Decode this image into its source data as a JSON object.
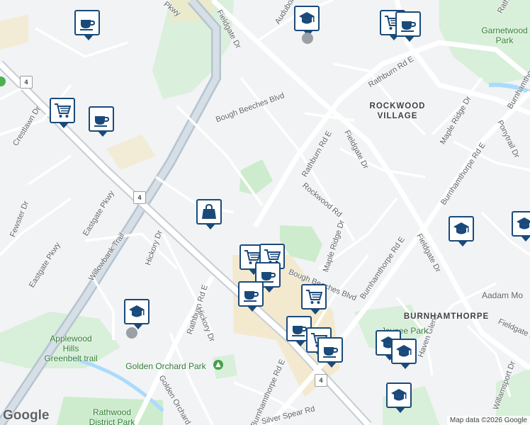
{
  "map": {
    "colors": {
      "land": "#f1f3f4",
      "road": "#ffffff",
      "highway": "#b6c4d1",
      "park": "#cdeccd",
      "water": "#aadaff",
      "commercial": "#f3e6c2",
      "marker_border": "#1a4a7a"
    },
    "streets": [
      {
        "name": "Eastgate Pkwy"
      },
      {
        "name": "Eastgate Pkwy"
      },
      {
        "name": "Pkwy"
      },
      {
        "name": "Fieldgate Dr"
      },
      {
        "name": "Fieldgate Dr"
      },
      {
        "name": "Fieldgate Dr"
      },
      {
        "name": "Fieldgate Dr"
      },
      {
        "name": "Audubon"
      },
      {
        "name": "Rathburn Rd E"
      },
      {
        "name": "Rathburn Rd E"
      },
      {
        "name": "Rathburn Rd E"
      },
      {
        "name": "Rathburn Rd E"
      },
      {
        "name": "Burnhamthorpe Rd E"
      },
      {
        "name": "Burnhamthorpe Rd E"
      },
      {
        "name": "Burnhamthorpe Rd E"
      },
      {
        "name": "Burnhamthorpe"
      },
      {
        "name": "Bough Beeches Blvd"
      },
      {
        "name": "Bough Beeches Blvd"
      },
      {
        "name": "Rockwood Rd"
      },
      {
        "name": "Maple Ridge Dr"
      },
      {
        "name": "Maple Ridge Dr"
      },
      {
        "name": "Crestlawn Dr"
      },
      {
        "name": "Fewster Dr"
      },
      {
        "name": "Willowbank Trail"
      },
      {
        "name": "Hickory Dr"
      },
      {
        "name": "Hickory Dr"
      },
      {
        "name": "Golden Orchard Dr"
      },
      {
        "name": "Silver Spear Rd"
      },
      {
        "name": "Ponytrail Dr"
      },
      {
        "name": "Willamsport Dr"
      },
      {
        "name": "Haven Glenn"
      }
    ],
    "route_shields": [
      "4",
      "4",
      "4"
    ],
    "neighborhoods": [
      "ROCKWOOD VILLAGE",
      "BURNHAMTHORPE"
    ],
    "parks": [
      "Garnetwood Park",
      "Golden Orchard Park",
      "Applewood Hills Greenbelt trail",
      "Rathwood District Park",
      "Jaycee Park"
    ],
    "places": [
      "Aadam Mo"
    ],
    "markers": [
      {
        "icon": "coffee-icon"
      },
      {
        "icon": "school-icon"
      },
      {
        "icon": "shopping-cart-icon"
      },
      {
        "icon": "coffee-icon"
      },
      {
        "icon": "shopping-cart-icon"
      },
      {
        "icon": "coffee-icon"
      },
      {
        "icon": "shopping-bag-icon"
      },
      {
        "icon": "shopping-cart-icon"
      },
      {
        "icon": "shopping-cart-icon"
      },
      {
        "icon": "coffee-icon"
      },
      {
        "icon": "coffee-icon"
      },
      {
        "icon": "shopping-cart-icon"
      },
      {
        "icon": "school-icon"
      },
      {
        "icon": "coffee-icon"
      },
      {
        "icon": "shopping-cart-icon"
      },
      {
        "icon": "coffee-icon"
      },
      {
        "icon": "school-icon"
      },
      {
        "icon": "school-icon"
      },
      {
        "icon": "school-icon"
      },
      {
        "icon": "school-icon"
      },
      {
        "icon": "school-icon"
      }
    ],
    "google_logo": "Google",
    "credit": "Map data ©2026 Google"
  }
}
